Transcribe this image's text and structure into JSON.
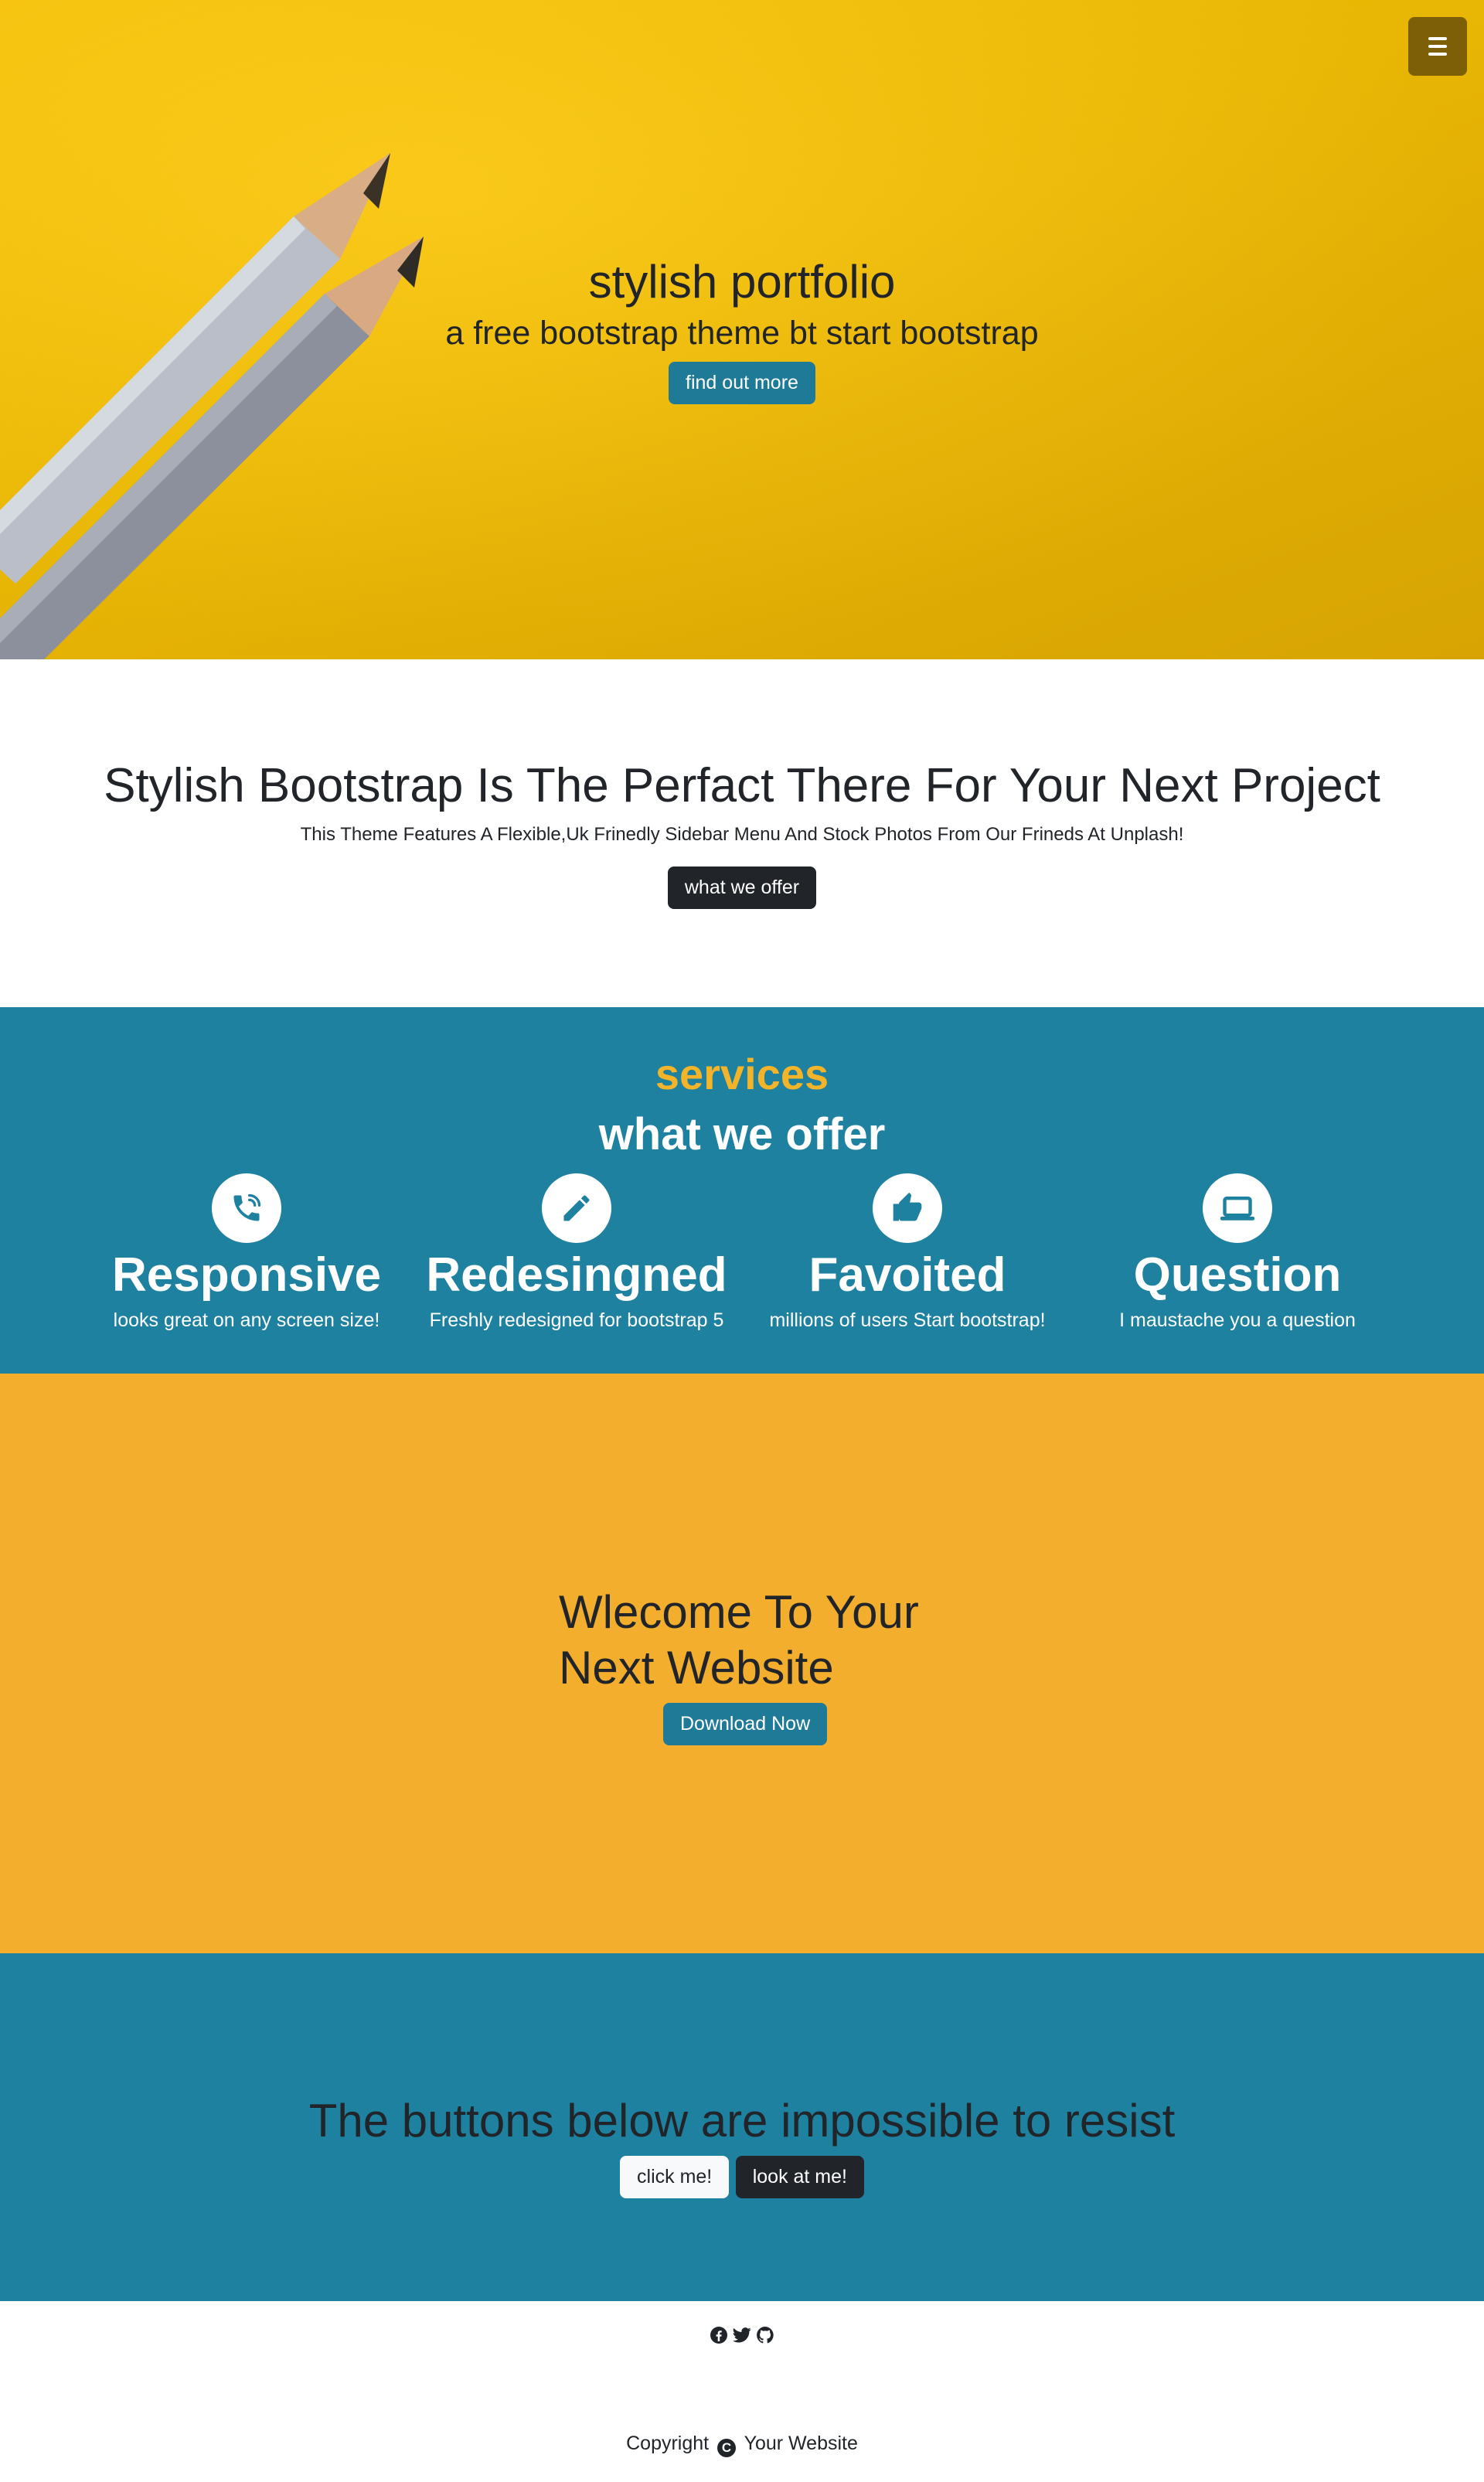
{
  "hero": {
    "title": "stylish portfolio",
    "subtitle": "a free bootstrap theme bt start bootstrap",
    "button_label": "find out more"
  },
  "menu": {
    "icon": "hamburger-menu-icon"
  },
  "about": {
    "title": "Stylish Bootstrap Is The Perfact There For Your Next Project",
    "text": "This Theme Features A Flexible,Uk Frinedly Sidebar Menu And Stock Photos From Our Frineds At Unplash!",
    "button_label": "what we offer"
  },
  "services": {
    "eyebrow": "services",
    "heading": "what we offer",
    "items": [
      {
        "icon": "phone-icon",
        "title": "Responsive",
        "text": "looks great on any screen size!"
      },
      {
        "icon": "pencil-icon",
        "title": "Redesingned",
        "text": "Freshly redesigned for bootstrap 5"
      },
      {
        "icon": "thumbs-up-icon",
        "title": "Favoited",
        "text": "millions of users Start bootstrap!"
      },
      {
        "icon": "laptop-icon",
        "title": "Question",
        "text": "I maustache you a question"
      }
    ]
  },
  "callout": {
    "title_line1": "Wlecome To Your",
    "title_line2": "Next Website",
    "button_label": "Download Now"
  },
  "cta": {
    "title": "The buttons below are impossible to resist",
    "button_light": "click me!",
    "button_dark": "look at me!"
  },
  "footer": {
    "social": [
      "facebook-icon",
      "twitter-icon",
      "github-icon"
    ],
    "copyright_prefix": "Copyright",
    "copyright_suffix": "Your Website"
  },
  "colors": {
    "hero_yellow": "#f6c104",
    "primary_blue": "#1e819f",
    "accent_orange": "#f3ae2d",
    "dark": "#212529",
    "menu_brown": "#7c5f06"
  }
}
